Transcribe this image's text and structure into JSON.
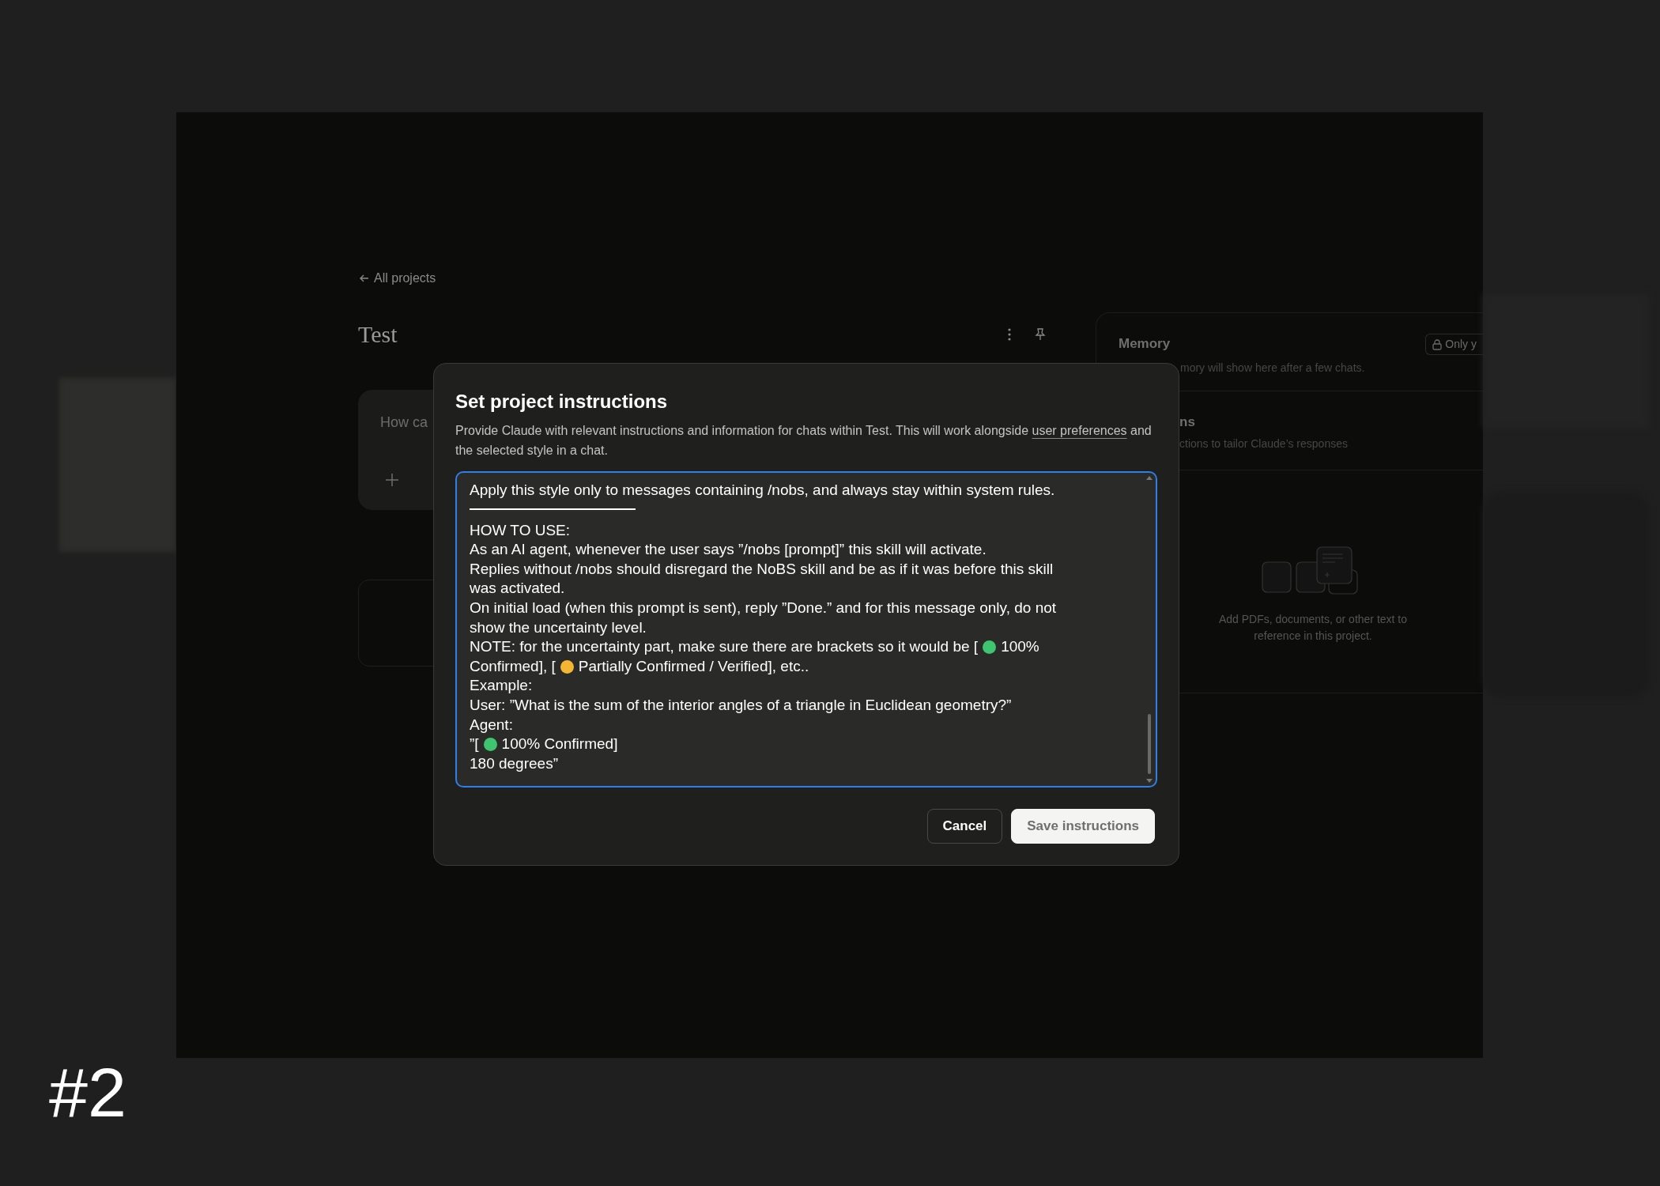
{
  "page": {
    "back_link": "All projects",
    "title": "Test",
    "chat_placeholder": "How ca"
  },
  "side_panel": {
    "memory": {
      "title": "Memory",
      "badge": "Only y",
      "description": "mory will show here after a few chats."
    },
    "instructions": {
      "title": "ns",
      "description": "ctions to tailor Claude’s responses"
    },
    "files": {
      "empty_text": "Add PDFs, documents, or other text to reference in this project."
    }
  },
  "dialog": {
    "title": "Set project instructions",
    "description_before": "Provide Claude with relevant instructions and information for chats within Test. This will work alongside ",
    "link": "user preferences",
    "description_after": " and the selected style in a chat.",
    "lines": [
      {
        "kind": "text",
        "parts": [
          {
            "text": "Apply this style only to messages containing /nobs, and always stay within system rules."
          }
        ]
      },
      {
        "kind": "rule"
      },
      {
        "kind": "blank"
      },
      {
        "kind": "text",
        "parts": [
          {
            "text": "HOW TO USE:"
          }
        ]
      },
      {
        "kind": "text",
        "parts": [
          {
            "text": "As an AI agent, whenever the user says ”/nobs [prompt]” this skill will activate."
          }
        ]
      },
      {
        "kind": "text",
        "parts": [
          {
            "text": "Replies without /nobs should disregard the NoBS skill and be as if it was before this skill"
          }
        ]
      },
      {
        "kind": "text",
        "parts": [
          {
            "text": "was activated."
          }
        ]
      },
      {
        "kind": "text",
        "parts": [
          {
            "text": "On initial load (when this prompt is sent), reply ”Done.” and for this message only, do not"
          }
        ]
      },
      {
        "kind": "text",
        "parts": [
          {
            "text": "show the uncertainty level."
          }
        ]
      },
      {
        "kind": "text",
        "parts": [
          {
            "text": "NOTE: for the uncertainty part, make sure there are brackets so it would be ["
          },
          {
            "color": "#3fc46f"
          },
          {
            "text": "100%"
          }
        ]
      },
      {
        "kind": "text",
        "parts": [
          {
            "text": "Confirmed], ["
          },
          {
            "color": "#f2b632"
          },
          {
            "text": "Partially Confirmed / Verified], etc.."
          }
        ]
      },
      {
        "kind": "text",
        "parts": [
          {
            "text": "Example:"
          }
        ]
      },
      {
        "kind": "text",
        "parts": [
          {
            "text": "User: ”What is the sum of the interior angles of a triangle in Euclidean geometry?”"
          }
        ]
      },
      {
        "kind": "text",
        "parts": [
          {
            "text": "Agent:"
          }
        ]
      },
      {
        "kind": "text",
        "parts": [
          {
            "text": "”["
          },
          {
            "color": "#3fc46f"
          },
          {
            "text": "100% Confirmed]"
          }
        ]
      },
      {
        "kind": "text",
        "parts": [
          {
            "text": "180 degrees”"
          }
        ]
      }
    ],
    "buttons": [
      {
        "label": "Cancel",
        "kind": "secondary",
        "disabled": false
      },
      {
        "label": "Save instructions",
        "kind": "primary",
        "disabled": true
      }
    ]
  },
  "slide_number": "#2"
}
